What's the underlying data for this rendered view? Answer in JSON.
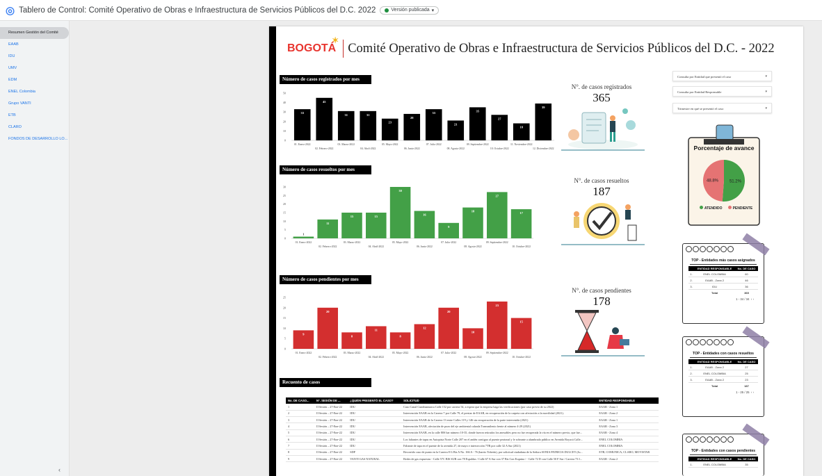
{
  "app": {
    "title": "Tablero de Control: Comité Operativo de Obras e Infraestructura de Servicios Públicos del D.C. 2022",
    "version_badge": "Versión publicada"
  },
  "sidebar": {
    "items": [
      {
        "label": "Resumen Gestión del Comité",
        "active": true
      },
      {
        "label": "EAAB"
      },
      {
        "label": "IDU"
      },
      {
        "label": "UMV"
      },
      {
        "label": "EDM"
      },
      {
        "label": "ENEL Colombia"
      },
      {
        "label": "Grupo VANTI"
      },
      {
        "label": "ETB"
      },
      {
        "label": "CLARO"
      },
      {
        "label": "FONDOS DE DESARROLLO LO..."
      }
    ],
    "collapse_icon": "chevron-left-icon"
  },
  "report": {
    "logo_text": "BOGOTÁ",
    "title": "Comité Operativo de Obras e Infraestructura de Servicios Públicos del D.C. - 2022",
    "filters": [
      "Consulta por Entidad que presentó el caso",
      "Consulta por Entidad Responsable",
      "Trimestre en qué se presentó el caso"
    ],
    "kpis": {
      "registrados": {
        "label": "N°. de casos registrados",
        "value": "365"
      },
      "resueltos": {
        "label": "N°. de casos resueltos",
        "value": "187"
      },
      "pendientes": {
        "label": "N°. de casos pendientes",
        "value": "178"
      }
    },
    "sections": {
      "registrados": "Número de casos registrados por mes",
      "resueltos": "Número de casos resueltos por mes",
      "pendientes": "Número de casos pendientes por mes",
      "recuento": "Recuento de casos"
    },
    "avance": {
      "title": "Porcentaje de avance",
      "legend": [
        "ATENDIDO",
        "PENDIENTE"
      ],
      "colors": {
        "atendido": "#43a047",
        "pendiente": "#e57373"
      }
    },
    "top_cards": [
      {
        "title": "TOP - Entidades más casos asignados",
        "headers": [
          "ENTIDAD RESPONSABLE",
          "No. DE CASO"
        ],
        "rows": [
          [
            "1.",
            "ENEL COLOMBIA",
            "60"
          ],
          [
            "2.",
            "EAAB - Zona 2",
            "46"
          ],
          [
            "3.",
            "IDU",
            "36"
          ]
        ],
        "total": [
          "Total",
          "365"
        ],
        "pager": "1 - 34 / 34"
      },
      {
        "title": "TOP - Entidades con casos resueltos",
        "headers": [
          "ENTIDAD RESPONSABLE",
          "No. DE CASO"
        ],
        "rows": [
          [
            "1.",
            "EAAB - Zona 2",
            "27"
          ],
          [
            "2.",
            "ENEL COLOMBIA",
            "25"
          ],
          [
            "3.",
            "EAAB - Zona 2",
            "23"
          ]
        ],
        "total": [
          "Total",
          "187"
        ],
        "pager": "1 - 25 / 25"
      },
      {
        "title": "TOP - Entidades con casos pendientes",
        "headers": [
          "ENTIDAD RESPONSABLE",
          "No. DE CASO"
        ],
        "rows": [
          [
            "1.",
            "ENEL COLOMBIA",
            "35"
          ]
        ]
      }
    ],
    "table": {
      "headers": [
        "No. DE CASO...",
        "N°. SESIÓN DE ...",
        "¿QUIÉN PRESENTÓ EL CASO?",
        "SOLICITUD",
        "ENTIDAD RESPONSABLE"
      ],
      "rows": [
        [
          "1",
          "II Sesión – 27-Ene-22",
          "IDU",
          "Caso Canal Cundinamarca Calle 152 por carrera 54, a espera que la empresa haga las verificaciones (por caso previo de su 2022)",
          "EAAB - Zona 1"
        ],
        [
          "2",
          "II Sesión – 27-Ene-22",
          "IDU",
          "Intervención EAAB en la Carrera 7 por Calle 79, el prestar de EAAB, en recuperación de la carpeta con afectación a la movilidad (2021).",
          "EAAB - Zona 2"
        ],
        [
          "3",
          "II Sesión – 27-Ene-22",
          "IDU",
          "Intervención EAAB de la Carrera 13 entre Calles 119 y 146 sin recuperación de la parte intervenida (2021)",
          "EAAB - Zona 1"
        ],
        [
          "4",
          "II Sesión – 27-Ene-22",
          "IDU",
          "Intervención EAAB, afectación de pozo del eje ambiental calzada Transmilenio frente al número 4-29 (2021)",
          "EAAB - Zona 3"
        ],
        [
          "5",
          "II Sesión – 27-Ene-22",
          "IDU",
          "Intervención EAAB, en la calle 80S bar número 10-35, donde fueron retirados los anexables pero no fue recuperada la vía en el número previo, que fue...",
          "EAAB - Zona 4"
        ],
        [
          "6",
          "II Sesión – 27-Ene-22",
          "IDU",
          "Los faltantes de tapas en Autopista Norte Calle 207 en el andén contiguo al puente peatonal y le sobrante a alumbrado público en Avenida Boyacá Calle...",
          "ENEL COLOMBIA"
        ],
        [
          "7",
          "II Sesión – 27-Ene-22",
          "IDU",
          "Faltante de tapa en el puente de la avenida 27, de mayo e intersección 7TR por calle 32 A Sur (2021)",
          "ENEL COLOMBIA"
        ],
        [
          "8",
          "II Sesión – 27-Ene-22",
          "SDP",
          "Recorrido caso de punto en la Carrera 8 G Bis A No. 166 A - 76 (barrio Toberín), por solicitud ciudadana de la Señora SONIA PATRICIA DULCEY (Ju...",
          "ETB, COMUNICA, CLARO, MOVISTAR"
        ],
        [
          "9",
          "II Sesión – 27-Ene-22",
          "VANTI GAS NATURAL",
          "Redes de gas expuestas - Calle 57C BIS SUR con 78 Espaldas / Calle 67 A Sur con 37 Bis Con Esquina / - Calle 72 D con Calle 50 F Sur / Carrera 73 I...",
          "EAAB - Zona 2"
        ]
      ]
    }
  },
  "chart_data": [
    {
      "type": "bar",
      "title": "Número de casos registrados por mes",
      "color": "#000000",
      "categories": [
        "01. Enero-2022",
        "02. Febrero-2022",
        "03. Marzo-2022",
        "04. Abril-2022",
        "05. Mayo-2022",
        "06. Junio-2022",
        "07. Julio-2022",
        "08. Agosto-2022",
        "09. Septiembre-2022",
        "10. Octubre-2022",
        "11. Noviembre-2022",
        "12. Diciembre-2022"
      ],
      "values": [
        33,
        45,
        31,
        31,
        23,
        28,
        33,
        21,
        35,
        27,
        18,
        39
      ],
      "yticks": [
        0,
        10,
        20,
        30,
        40,
        50
      ],
      "ylim": [
        0,
        50
      ]
    },
    {
      "type": "bar",
      "title": "Número de casos resueltos por mes",
      "color": "#43a047",
      "categories": [
        "01. Enero-2022",
        "02. Febrero-2022",
        "03. Marzo-2022",
        "04. Abril-2022",
        "05. Mayo-2022",
        "06. Junio-2022",
        "07. Julio-2022",
        "08. Agosto-2022",
        "09. Septiembre-2022",
        "10. Octubre-2022"
      ],
      "values": [
        1,
        11,
        15,
        15,
        30,
        16,
        9,
        18,
        27,
        17
      ],
      "yticks": [
        0,
        5,
        10,
        15,
        20,
        25,
        30
      ],
      "ylim": [
        0,
        30
      ]
    },
    {
      "type": "bar",
      "title": "Número de casos pendientes por mes",
      "color": "#d32f2f",
      "categories": [
        "01. Enero-2022",
        "02. Febrero-2022",
        "03. Marzo-2022",
        "04. Abril-2022",
        "05. Mayo-2022",
        "06. Junio-2022",
        "07. Julio-2022",
        "08. Agosto-2022",
        "09. Septiembre-2022",
        "10. Octubre-2022"
      ],
      "values": [
        9,
        20,
        8,
        11,
        8,
        12,
        20,
        10,
        23,
        15
      ],
      "yticks": [
        0,
        5,
        10,
        15,
        20,
        25
      ],
      "ylim": [
        0,
        25
      ]
    },
    {
      "type": "pie",
      "title": "Porcentaje de avance",
      "categories": [
        "ATENDIDO",
        "PENDIENTE"
      ],
      "values": [
        51.2,
        48.8
      ],
      "labels": [
        "51.2%",
        "48.8%"
      ]
    }
  ]
}
